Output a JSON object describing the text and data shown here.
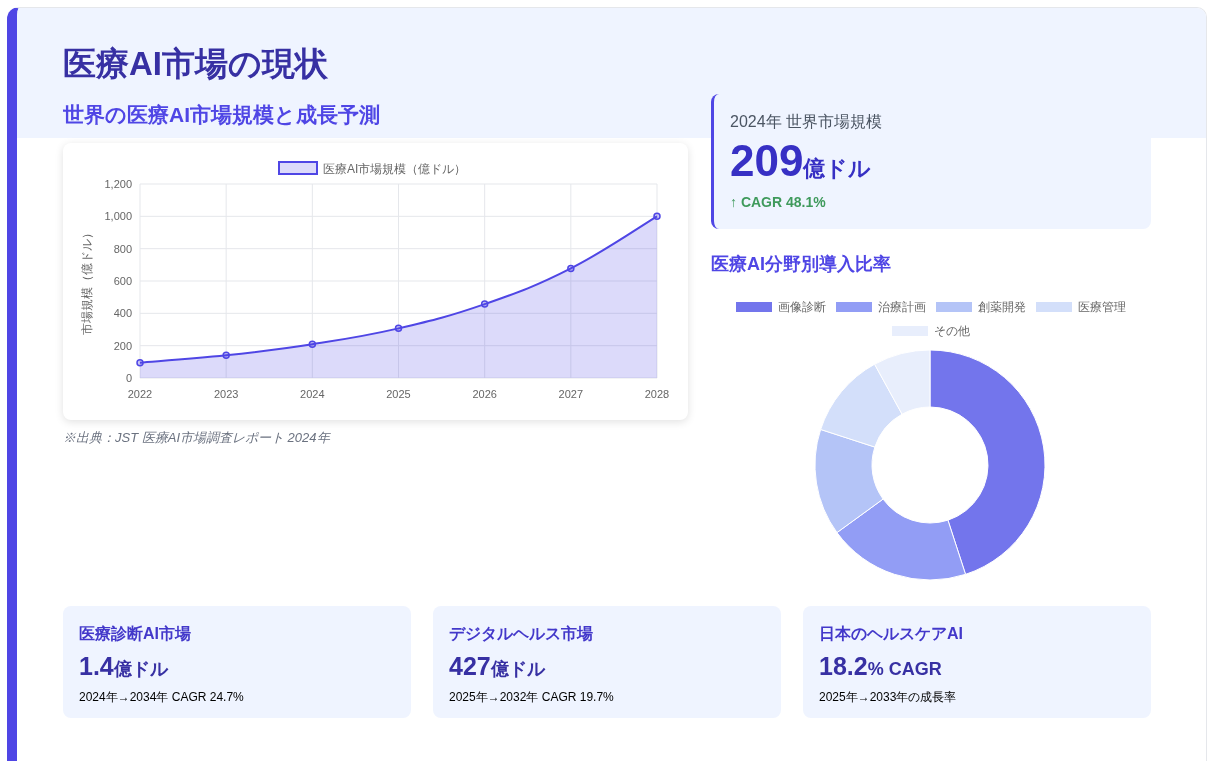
{
  "page": {
    "title": "医療AI市場の現状"
  },
  "market": {
    "heading": "世界の医療AI市場規模と成長予測",
    "chart_data": {
      "type": "area",
      "ylabel": "市場規模（億ドル）",
      "categories": [
        "2022",
        "2023",
        "2024",
        "2025",
        "2026",
        "2027",
        "2028"
      ],
      "series": [
        {
          "name": "医療AI市場規模（億ドル）",
          "color": "#4f46e5",
          "values": [
            95,
            140,
            209,
            307,
            457,
            678,
            1000
          ]
        }
      ],
      "ylim": [
        0,
        1200
      ],
      "grid": true,
      "yticks": [
        0,
        200,
        400,
        600,
        800,
        {
          "value": 1000,
          "label": "1,000"
        },
        {
          "value": 1200,
          "label": "1,200"
        }
      ]
    },
    "source": "※出典：JST 医療AI市場調査レポート 2024年"
  },
  "stat": {
    "label": "2024年 世界市場規模",
    "value": "209",
    "unit": "億ドル",
    "change": "↑ CAGR 48.1%"
  },
  "share": {
    "heading": "医療AI分野別導入比率",
    "chart_data": {
      "type": "donut",
      "categories": [
        "画像診断",
        "治療計画",
        "創薬開発",
        "医療管理",
        "その他"
      ],
      "values": [
        45,
        20,
        15,
        12,
        8
      ],
      "colors": [
        "#7375ec",
        "#929df5",
        "#b4c4f7",
        "#d3dffa",
        "#e8eefc"
      ]
    }
  },
  "cards": [
    {
      "title": "医療診断AI市場",
      "value": "1.4",
      "unit": "億ドル",
      "note": "2024年→2034年 CAGR 24.7%"
    },
    {
      "title": "デジタルヘルス市場",
      "value": "427",
      "unit": "億ドル",
      "note": "2025年→2032年 CAGR 19.7%"
    },
    {
      "title": "日本のヘルスケアAI",
      "value": "18.2",
      "unit": "% CAGR",
      "note": "2025年→2033年の成長率"
    }
  ]
}
